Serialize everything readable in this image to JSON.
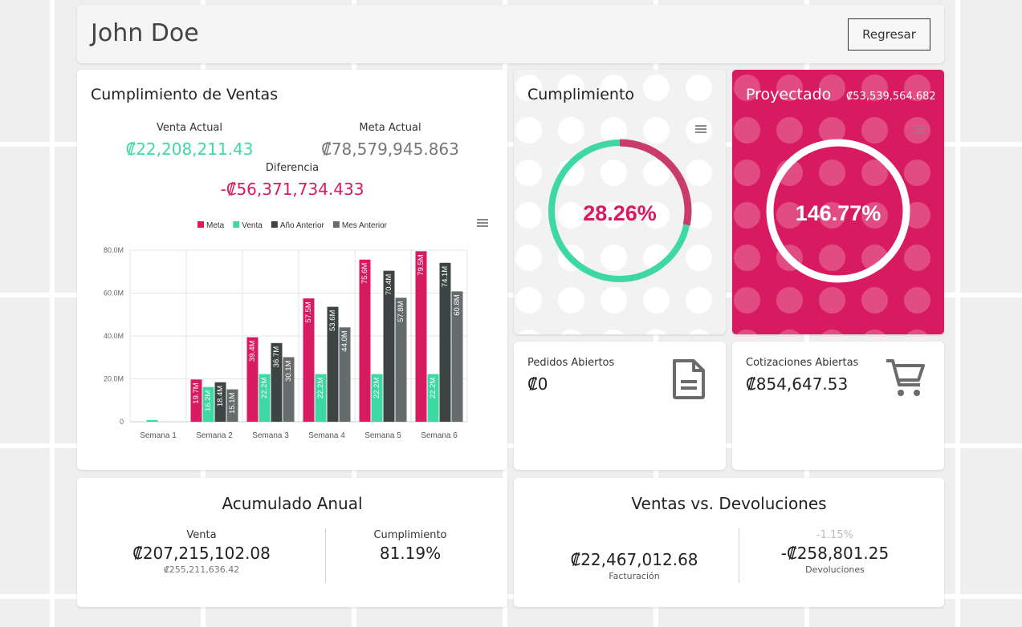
{
  "header": {
    "name": "John Doe",
    "back_label": "Regresar"
  },
  "sales": {
    "title": "Cumplimiento de Ventas",
    "venta_actual_label": "Venta Actual",
    "venta_actual_value": "₡22,208,211.43",
    "meta_actual_label": "Meta Actual",
    "meta_actual_value": "₡78,579,945.863",
    "diferencia_label": "Diferencia",
    "diferencia_value": "-₡56,371,734.433"
  },
  "chart_data": {
    "type": "bar",
    "categories": [
      "Semana 1",
      "Semana 2",
      "Semana 3",
      "Semana 4",
      "Semana 5",
      "Semana 6"
    ],
    "series": [
      {
        "name": "Meta",
        "color": "#d81b60",
        "values": [
          0,
          19.7,
          39.4,
          57.5,
          75.6,
          79.5
        ],
        "labels": [
          "",
          "19.7M",
          "39.4M",
          "57.5M",
          "75.6M",
          "79.5M"
        ]
      },
      {
        "name": "Venta",
        "color": "#3ed8a3",
        "values": [
          0.8,
          16.2,
          22.2,
          22.2,
          22.2,
          22.2
        ],
        "labels": [
          "",
          "16.2M",
          "22.2M",
          "22.2M",
          "22.2M",
          "22.2M"
        ]
      },
      {
        "name": "Año Anterior",
        "color": "#3d4444",
        "values": [
          0,
          18.4,
          36.7,
          53.6,
          70.4,
          74.1
        ],
        "labels": [
          "",
          "18.4M",
          "36.7M",
          "53.6M",
          "70.4M",
          "74.1M"
        ]
      },
      {
        "name": "Mes Anterior",
        "color": "#666b6b",
        "values": [
          0,
          15.1,
          30.1,
          44.0,
          57.8,
          60.8
        ],
        "labels": [
          "",
          "15.1M",
          "30.1M",
          "44.0M",
          "57.8M",
          "60.8M"
        ]
      }
    ],
    "yticks": [
      "0",
      "20.0M",
      "40.0M",
      "60.0M",
      "80.0M"
    ],
    "ylim": [
      0,
      80
    ],
    "grid": true,
    "legend": "top-center"
  },
  "cumplimiento": {
    "title": "Cumplimiento",
    "percent_text": "28.26%",
    "percent_value": 28.26
  },
  "proyectado": {
    "title": "Proyectado",
    "amount": "₡53,539,564.682",
    "percent_text": "146.77%",
    "percent_value": 146.77
  },
  "pedidos": {
    "label": "Pedidos Abiertos",
    "value": "₡0",
    "icon": "document-icon"
  },
  "cotizaciones": {
    "label": "Cotizaciones Abiertas",
    "value": "₡854,647.53",
    "icon": "cart-icon"
  },
  "acumulado": {
    "title": "Acumulado Anual",
    "venta_label": "Venta",
    "venta_value": "₡207,215,102.08",
    "venta_sub": "₡255,211,636.42",
    "cumpl_label": "Cumplimiento",
    "cumpl_value": "81.19%"
  },
  "ventas_dev": {
    "title": "Ventas vs. Devoluciones",
    "facturacion_value": "₡22,467,012.68",
    "facturacion_label": "Facturación",
    "dev_pct": "-1.15%",
    "dev_value": "-₡258,801.25",
    "dev_label": "Devoluciones"
  },
  "colors": {
    "accent": "#d81b60",
    "green": "#3ed8a3",
    "dark": "#3d4444"
  }
}
